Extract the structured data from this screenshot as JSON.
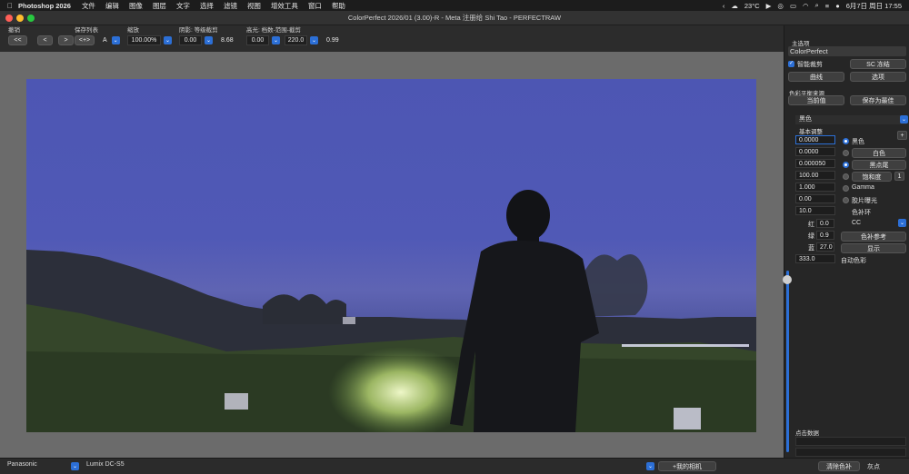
{
  "menubar": {
    "app_name": "Photoshop 2026",
    "items": [
      "文件",
      "编辑",
      "图像",
      "图层",
      "文字",
      "选择",
      "滤镜",
      "视图",
      "增效工具",
      "窗口",
      "帮助"
    ],
    "temperature": "23°C",
    "date_time": "6月7日 周日 17:55"
  },
  "window": {
    "title": "ColorPerfect 2026/01 (3.00)-R -  Meta 注册给 Shi Tao - PERFECTRAW"
  },
  "toolbar": {
    "undo_label": "撤销",
    "first_btn": "<<",
    "prev_btn": "<",
    "next_btn": ">",
    "savelist_label": "保存列表",
    "swap_btn": "<+>",
    "list_value": "A",
    "zoom_label": "缩放",
    "zoom_value": "100.00%",
    "shadow_label": "阴影: 等级截剪",
    "shadow_value": "0.00",
    "shadow_readout": "8.68",
    "highlight_label": "高光: 档数-范围-截剪",
    "highlight_value": "0.00",
    "range_value": "220.0",
    "highlight_readout": "0.99"
  },
  "header_buttons": {
    "help": "帮助",
    "ok": "确定",
    "cancel": "取消"
  },
  "panel": {
    "main_options_label": "主选项",
    "plugin_name": "ColorPerfect",
    "smart_crop_label": "智能裁剪",
    "sc_freeze_btn": "SC 冻结",
    "curve_btn": "曲线",
    "options_btn": "选项",
    "balance_source_label": "色彩平衡来源",
    "current_value_btn": "当前值",
    "save_best_btn": "保存为最佳",
    "film_select": "黑色",
    "basic_adjust_label": "基本调整",
    "plus": "+",
    "fields": [
      "0.0000",
      "0.0000",
      "0.000050",
      "100.00",
      "1.000",
      "0.00",
      "10.0"
    ],
    "radio_black": "黑色",
    "btn_white": "白色",
    "btn_black_tail": "黑点尾",
    "btn_saturation": "饱和度",
    "sat_small": "1",
    "radio_gamma": "Gamma",
    "radio_film_exposure": "胶片曝光",
    "color_ring_label": "色补环",
    "red_label": "红",
    "red_value": "0.0",
    "green_label": "绿",
    "green_value": "0.9",
    "blue_label": "蓝",
    "blue_value": "27.0",
    "cc_select": "CC",
    "color_ref_btn": "色补参考",
    "show_btn": "显示",
    "auto_value": "333.0",
    "auto_color_label": "自动色彩",
    "click_data_label": "点击数据"
  },
  "statusbar": {
    "brand": "Panasonic",
    "model": "Lumix DC-S5",
    "my_camera_btn": "+我的相机",
    "clear_btn": "清除色补",
    "gray_point": "灰点"
  },
  "colors": {
    "accent": "#2c6fd6",
    "sky": "#4d56b3"
  }
}
